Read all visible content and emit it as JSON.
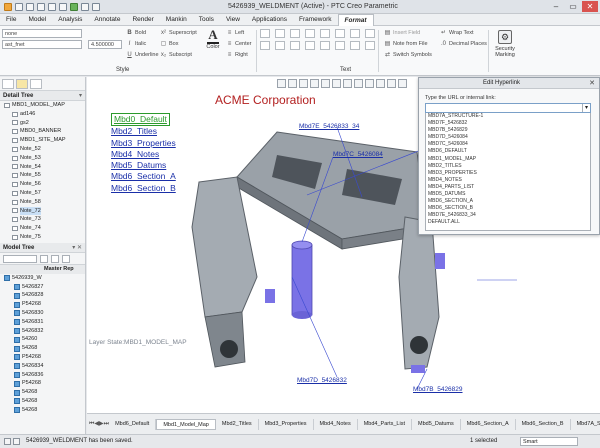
{
  "window": {
    "title": "5426939_WELDMENT (Active) - PTC Creo Parametric"
  },
  "ribbon_tabs": [
    "File",
    "Model",
    "Analysis",
    "Annotate",
    "Render",
    "Mankin",
    "Tools",
    "View",
    "Applications",
    "Framework",
    "Format"
  ],
  "ribbon": {
    "style_field_1": "none",
    "style_field_2": "ast_fnet",
    "height_value": "4.500000",
    "bold": "Bold",
    "italic": "Italic",
    "underline": "Underline",
    "superscript": "Superscript",
    "box": "Box",
    "subscript": "Subscript",
    "color": "Color",
    "left": "Left",
    "center": "Center",
    "right": "Right",
    "insert_field": "Insert Field",
    "note_from_file": "Note from File",
    "switch_symbols": "Switch Symbols",
    "wrap_text": "Wrap Text",
    "decimal_places": "Decimal Places",
    "security_marking": "Security Marking",
    "group_style": "Style",
    "group_text": "Text"
  },
  "detail_tree": {
    "header": "Detail Tree",
    "items": [
      "MBD1_MODEL_MAP",
      "ad146",
      "gs2",
      "MBD0_BANNER",
      "MBD1_SITE_MAP",
      "Note_52",
      "Note_53",
      "Note_54",
      "Note_55",
      "Note_56",
      "Note_57",
      "Note_58",
      "Note_72",
      "Note_73",
      "Note_74",
      "Note_75"
    ],
    "selected_index": 12
  },
  "model_tree": {
    "header": "Model Tree",
    "master_rep": "Master Rep",
    "items": [
      "5426939_W",
      "5426827",
      "5426828",
      "P54268",
      "5426830",
      "5426831",
      "5426832",
      "54260",
      "54268",
      "P54268",
      "5426834",
      "5426836",
      "P54268",
      "54268",
      "54268",
      "54268"
    ]
  },
  "graphics": {
    "title": "ACME Corporation",
    "mbd_links": [
      "Mbd0_Default",
      "Mbd2_Titles",
      "Mbd3_Properties",
      "Mbd4_Notes",
      "Mbd5_Datums",
      "Mbd6_Section_A",
      "Mbd6_Section_B"
    ],
    "layer_state": "Layer State:MBD1_MODEL_MAP",
    "leaders": [
      "Mbd7E_5426833_34",
      "Mbd7C_5426084",
      "Mbd7D_5426832",
      "Mbd7B_5426829"
    ]
  },
  "hyperlink_dialog": {
    "title": "Edit Hyperlink",
    "prompt": "Type the URL or internal link:",
    "options": [
      "MBD7A_STRUCTURE-1",
      "MBD7F_5426832",
      "MBD7B_5426829",
      "MBD7D_5426084",
      "MBD7C_5426084",
      "MBD6_DEFAULT",
      "MBD1_MODEL_MAP",
      "MBD2_TITLES",
      "MBD3_PROPERTIES",
      "MBD4_NOTES",
      "MBD4_PARTS_LIST",
      "MBD5_DATUMS",
      "MBD6_SECTION_A",
      "MBD6_SECTION_B",
      "MBD7E_5426833_34",
      "DEFAULT.ALL"
    ]
  },
  "sheet_tabs": [
    "Mbd6_Default",
    "Mbd1_Model_Map",
    "Mbd2_Titles",
    "Mbd3_Properties",
    "Mbd4_Notes",
    "Mbd4_Parts_List",
    "Mbd5_Datums",
    "Mbd6_Section_A",
    "Mbd6_Section_B",
    "Mbd7A_Structure"
  ],
  "active_sheet_index": 1,
  "status": {
    "message": "5426939_WELDMENT has been saved.",
    "selected": "1 selected",
    "filter": "Smart"
  },
  "colors": {
    "title_red": "#b32020",
    "link_blue": "#1a2fa8",
    "highlight_green": "#2b9a2b",
    "part_gray": "#8e969e",
    "datum_purple": "#7a72e6"
  }
}
